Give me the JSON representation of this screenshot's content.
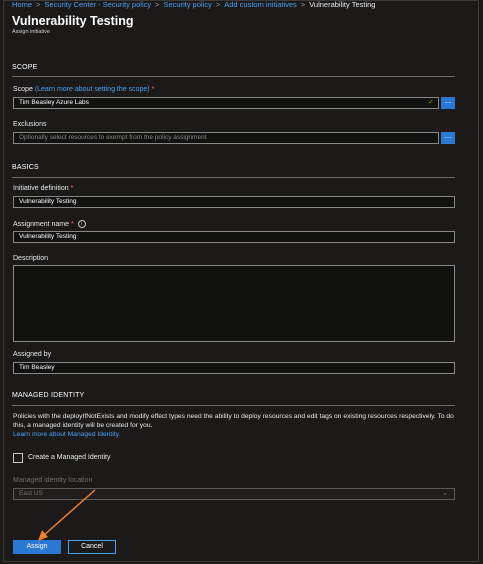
{
  "breadcrumb": [
    {
      "label": "Home"
    },
    {
      "label": "Security Center - Security policy"
    },
    {
      "label": "Security policy"
    },
    {
      "label": "Add custom initiatives"
    }
  ],
  "breadcrumb_current": "Vulnerability Testing",
  "header": {
    "title": "Vulnerability Testing",
    "subtitle": "Assign initiative"
  },
  "scope_section": {
    "heading": "SCOPE",
    "scope_label": "Scope",
    "scope_link": "(Learn more about setting the scope)",
    "scope_value": "Tim Beasley Azure Labs",
    "exclusions_label": "Exclusions",
    "exclusions_placeholder": "Optionally select resources to exempt from the policy assignment",
    "ellipsis": "..."
  },
  "basics_section": {
    "heading": "BASICS",
    "initiative_label": "Initiative definition",
    "initiative_value": "Vulnerability Testing",
    "assignment_label": "Assignment name",
    "assignment_value": "Vulnerability Testing",
    "description_label": "Description",
    "description_value": "",
    "assigned_by_label": "Assigned by",
    "assigned_by_value": "Tim Beasley"
  },
  "identity_section": {
    "heading": "MANAGED IDENTITY",
    "paragraph": "Policies with the deployIfNotExists and modify effect types need the ability to deploy resources and edit tags on existing resources respectively. To do this, a managed identity will be created for you.",
    "learn_more": "Learn more about Managed Identity.",
    "checkbox_label": "Create a Managed Identity",
    "checkbox_checked": false,
    "location_label": "Managed identity location",
    "location_value": "East US"
  },
  "buttons": {
    "assign": "Assign",
    "cancel": "Cancel"
  },
  "colors": {
    "accent": "#2b78d4",
    "link": "#4aa0f0",
    "annotation_arrow": "#f0802a",
    "required": "#ff6b6b"
  },
  "icons": {
    "valid": "check-icon",
    "info": "info-icon",
    "dropdown": "chevron-down-icon"
  }
}
